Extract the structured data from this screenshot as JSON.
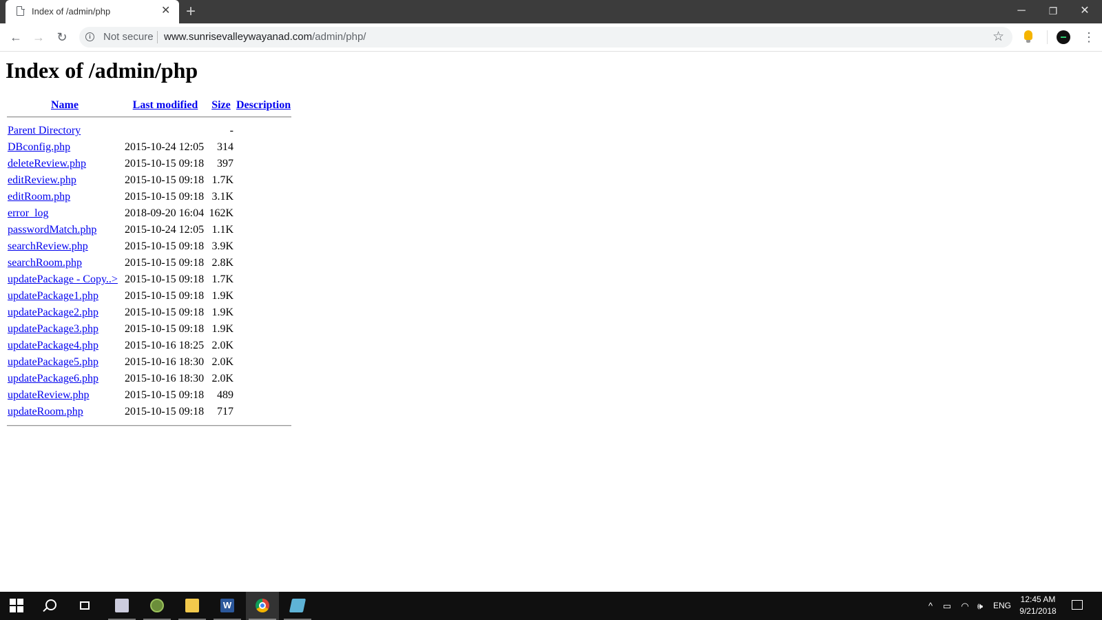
{
  "browser": {
    "tab_title": "Index of /admin/php",
    "not_secure": "Not secure",
    "url_host": "www.sunrisevalleywayanad.com",
    "url_path": "/admin/php/"
  },
  "page": {
    "heading": "Index of /admin/php",
    "columns": {
      "name": "Name",
      "last_modified": "Last modified",
      "size": "Size",
      "description": "Description"
    },
    "parent": {
      "name": "Parent Directory",
      "size": "-"
    },
    "files": [
      {
        "name": "DBconfig.php",
        "modified": "2015-10-24 12:05",
        "size": "314"
      },
      {
        "name": "deleteReview.php",
        "modified": "2015-10-15 09:18",
        "size": "397"
      },
      {
        "name": "editReview.php",
        "modified": "2015-10-15 09:18",
        "size": "1.7K"
      },
      {
        "name": "editRoom.php",
        "modified": "2015-10-15 09:18",
        "size": "3.1K"
      },
      {
        "name": "error_log",
        "modified": "2018-09-20 16:04",
        "size": "162K"
      },
      {
        "name": "passwordMatch.php",
        "modified": "2015-10-24 12:05",
        "size": "1.1K"
      },
      {
        "name": "searchReview.php",
        "modified": "2015-10-15 09:18",
        "size": "3.9K"
      },
      {
        "name": "searchRoom.php",
        "modified": "2015-10-15 09:18",
        "size": "2.8K"
      },
      {
        "name": "updatePackage - Copy..>",
        "modified": "2015-10-15 09:18",
        "size": "1.7K"
      },
      {
        "name": "updatePackage1.php",
        "modified": "2015-10-15 09:18",
        "size": "1.9K"
      },
      {
        "name": "updatePackage2.php",
        "modified": "2015-10-15 09:18",
        "size": "1.9K"
      },
      {
        "name": "updatePackage3.php",
        "modified": "2015-10-15 09:18",
        "size": "1.9K"
      },
      {
        "name": "updatePackage4.php",
        "modified": "2015-10-16 18:25",
        "size": "2.0K"
      },
      {
        "name": "updatePackage5.php",
        "modified": "2015-10-16 18:30",
        "size": "2.0K"
      },
      {
        "name": "updatePackage6.php",
        "modified": "2015-10-16 18:30",
        "size": "2.0K"
      },
      {
        "name": "updateReview.php",
        "modified": "2015-10-15 09:18",
        "size": "489"
      },
      {
        "name": "updateRoom.php",
        "modified": "2015-10-15 09:18",
        "size": "717"
      }
    ]
  },
  "taskbar": {
    "language": "ENG",
    "time": "12:45 AM",
    "date": "9/21/2018",
    "pinned_icons": [
      "windows-start-icon",
      "search-icon",
      "task-view-icon",
      "drive-app-icon",
      "globe-app-icon",
      "file-explorer-icon",
      "word-icon",
      "chrome-icon",
      "notepad-app-icon"
    ]
  },
  "colors": {
    "link": "#0000ee",
    "tabstrip": "#3c3c3c",
    "taskbar": "#101010"
  }
}
